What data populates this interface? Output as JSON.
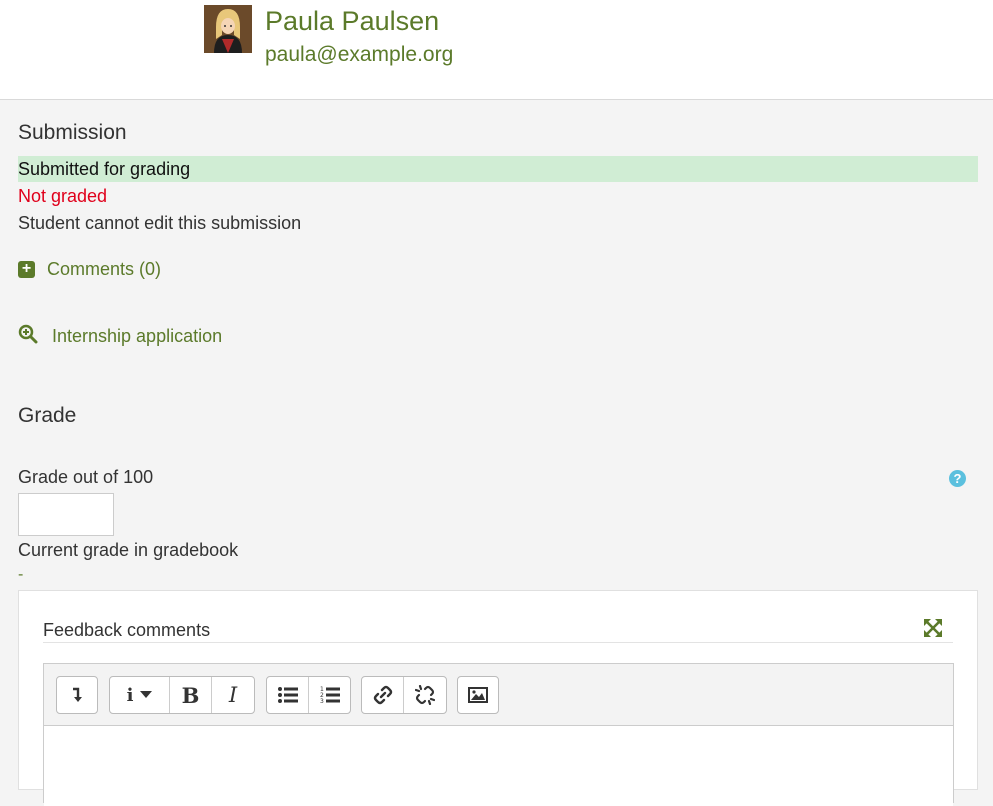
{
  "user": {
    "name": "Paula Paulsen",
    "email": "paula@example.org"
  },
  "submission": {
    "heading": "Submission",
    "status": "Submitted for grading",
    "grading_status": "Not graded",
    "edit_status": "Student cannot edit this submission",
    "comments_link": "Comments (0)",
    "plus_symbol": "+",
    "file_link": "Internship application"
  },
  "grade": {
    "heading": "Grade",
    "grade_label": "Grade out of 100",
    "grade_value": "",
    "help_symbol": "?",
    "current_label": "Current grade in gradebook",
    "current_value": "-"
  },
  "feedback": {
    "title": "Feedback comments",
    "toolbar_buttons": [
      "show-more-buttons-icon",
      "info-dropdown-icon",
      "bold-icon",
      "italic-icon",
      "bullet-list-icon",
      "numbered-list-icon",
      "link-icon",
      "unlink-icon",
      "image-icon"
    ],
    "bold_glyph": "B",
    "italic_glyph": "I",
    "info_glyph": "i"
  },
  "colors": {
    "accent": "#5b7a2a",
    "status_bg": "#d0edd4",
    "not_graded": "#e0001b",
    "help": "#5bc0de"
  }
}
